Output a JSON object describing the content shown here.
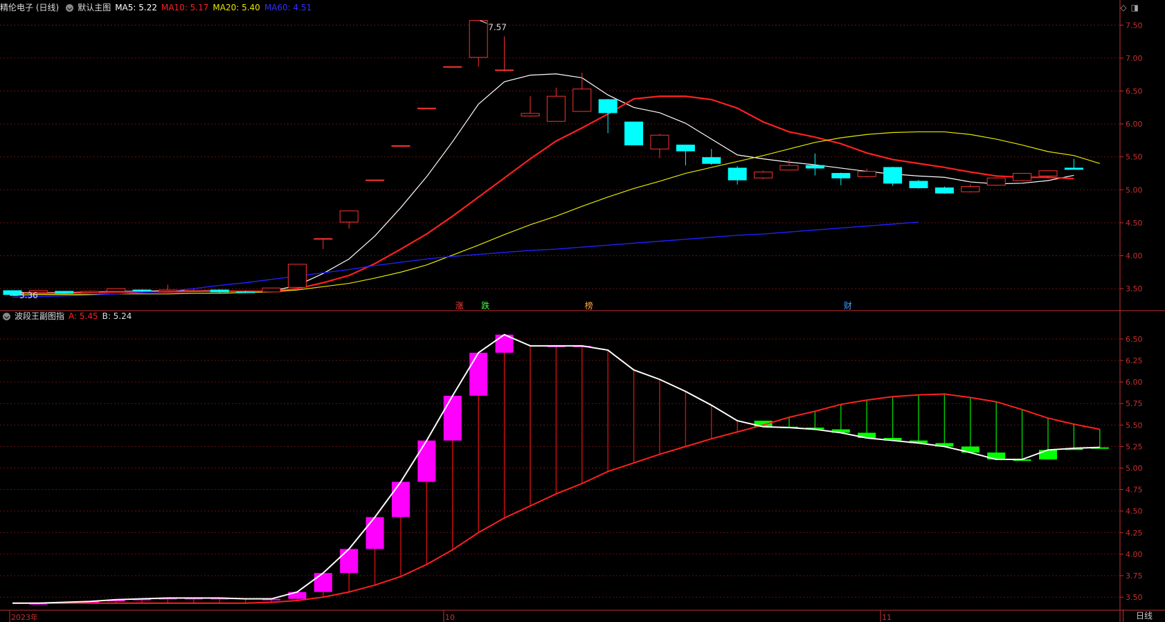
{
  "main_header": {
    "stock": "精伦电子 (日线)",
    "chart_name": "默认主图",
    "ma5": "MA5: 5.22",
    "ma10": "MA10: 5.17",
    "ma20": "MA20: 5.40",
    "ma60": "MA60: 4.51"
  },
  "sub_header": {
    "indicator": "波段王副图指",
    "a": "A: 5.45",
    "b": "B: 5.24"
  },
  "markers": [
    "涨",
    "跌",
    "榜",
    "财"
  ],
  "annotations": {
    "high": "7.57",
    "low": "3.36"
  },
  "x_labels": [
    "2023年",
    "10",
    "11"
  ],
  "period_tab": "日线",
  "icons": {
    "diamond": "diamond-icon",
    "window": "window-icon"
  },
  "colors": {
    "up": "#ff3232",
    "down": "#00ffff",
    "ma5": "#ffffff",
    "ma10": "#ff2020",
    "ma20": "#e8e800",
    "ma60": "#2020ff",
    "magenta": "#ff00ff",
    "green": "#00ff00"
  },
  "chart_data": [
    {
      "type": "candlestick",
      "title": "默认主图",
      "y_ticks": [
        "7.50",
        "7.00",
        "6.50",
        "6.00",
        "5.50",
        "5.00",
        "4.50",
        "4.00",
        "3.50"
      ],
      "ylim": [
        3.25,
        7.65
      ],
      "candles": [
        [
          3.47,
          3.41,
          3.47,
          3.41
        ],
        [
          3.44,
          3.47,
          3.47,
          3.43
        ],
        [
          3.46,
          3.43,
          3.46,
          3.42
        ],
        [
          3.44,
          3.46,
          3.47,
          3.43
        ],
        [
          3.46,
          3.5,
          3.5,
          3.45
        ],
        [
          3.48,
          3.47,
          3.49,
          3.45
        ],
        [
          3.46,
          3.48,
          3.56,
          3.45
        ],
        [
          3.47,
          3.47,
          3.5,
          3.45
        ],
        [
          3.48,
          3.45,
          3.49,
          3.43
        ],
        [
          3.45,
          3.44,
          3.47,
          3.43
        ],
        [
          3.45,
          3.51,
          3.51,
          3.44
        ],
        [
          3.52,
          3.87,
          3.87,
          3.52
        ],
        [
          4.26,
          4.26,
          4.26,
          4.1
        ],
        [
          4.51,
          4.68,
          4.68,
          4.41
        ],
        [
          5.15,
          5.15,
          5.15,
          5.15
        ],
        [
          5.67,
          5.67,
          5.67,
          5.67
        ],
        [
          6.24,
          6.24,
          6.24,
          6.24
        ],
        [
          6.87,
          6.87,
          6.87,
          6.87
        ],
        [
          7.01,
          7.57,
          7.57,
          6.87
        ],
        [
          6.82,
          6.82,
          7.33,
          6.8
        ],
        [
          6.12,
          6.16,
          6.42,
          6.11
        ],
        [
          6.04,
          6.42,
          6.55,
          6.04
        ],
        [
          6.19,
          6.53,
          6.78,
          6.19
        ],
        [
          6.37,
          6.17,
          6.38,
          5.86
        ],
        [
          6.03,
          5.68,
          6.03,
          5.68
        ],
        [
          5.62,
          5.83,
          5.85,
          5.48
        ],
        [
          5.68,
          5.59,
          5.68,
          5.37
        ],
        [
          5.49,
          5.4,
          5.62,
          5.38
        ],
        [
          5.33,
          5.15,
          5.36,
          5.08
        ],
        [
          5.18,
          5.27,
          5.29,
          5.16
        ],
        [
          5.3,
          5.37,
          5.46,
          5.3
        ],
        [
          5.37,
          5.33,
          5.55,
          5.22
        ],
        [
          5.25,
          5.18,
          5.26,
          5.07
        ],
        [
          5.2,
          5.28,
          5.32,
          5.19
        ],
        [
          5.34,
          5.1,
          5.35,
          5.06
        ],
        [
          5.13,
          5.03,
          5.15,
          5.02
        ],
        [
          5.03,
          4.95,
          5.05,
          4.94
        ],
        [
          4.97,
          5.05,
          5.08,
          4.96
        ],
        [
          5.07,
          5.18,
          5.19,
          5.06
        ],
        [
          5.14,
          5.25,
          5.25,
          5.13
        ],
        [
          5.21,
          5.29,
          5.3,
          5.17
        ],
        [
          5.33,
          5.31,
          5.47,
          5.31
        ]
      ],
      "series": [
        {
          "name": "MA5",
          "values": [
            3.44,
            3.44,
            3.44,
            3.45,
            3.46,
            3.46,
            3.47,
            3.47,
            3.47,
            3.46,
            3.46,
            3.55,
            3.73,
            3.95,
            4.3,
            4.73,
            5.2,
            5.73,
            6.3,
            6.64,
            6.74,
            6.76,
            6.7,
            6.44,
            6.25,
            6.17,
            6.01,
            5.77,
            5.53,
            5.47,
            5.42,
            5.38,
            5.33,
            5.28,
            5.24,
            5.21,
            5.19,
            5.12,
            5.09,
            5.1,
            5.14,
            5.22
          ]
        },
        {
          "name": "MA10",
          "values": [
            3.43,
            3.43,
            3.43,
            3.44,
            3.45,
            3.45,
            3.45,
            3.46,
            3.46,
            3.46,
            3.46,
            3.5,
            3.59,
            3.7,
            3.88,
            4.1,
            4.33,
            4.6,
            4.89,
            5.18,
            5.47,
            5.74,
            5.94,
            6.15,
            6.38,
            6.42,
            6.42,
            6.37,
            6.24,
            6.03,
            5.88,
            5.8,
            5.7,
            5.56,
            5.46,
            5.4,
            5.34,
            5.27,
            5.21,
            5.19,
            5.19,
            5.17
          ]
        },
        {
          "name": "MA20",
          "values": [
            3.4,
            3.41,
            3.41,
            3.41,
            3.42,
            3.42,
            3.42,
            3.43,
            3.43,
            3.44,
            3.45,
            3.48,
            3.53,
            3.58,
            3.66,
            3.75,
            3.86,
            4.01,
            4.16,
            4.32,
            4.47,
            4.6,
            4.75,
            4.89,
            5.02,
            5.13,
            5.25,
            5.34,
            5.43,
            5.52,
            5.62,
            5.72,
            5.79,
            5.84,
            5.87,
            5.88,
            5.88,
            5.84,
            5.77,
            5.68,
            5.58,
            5.52,
            5.4
          ]
        },
        {
          "name": "MA60",
          "values": [
            3.37,
            3.38,
            3.39,
            3.4,
            3.42,
            3.44,
            3.46,
            3.5,
            3.55,
            3.59,
            3.64,
            3.69,
            3.74,
            3.79,
            3.85,
            3.9,
            3.95,
            3.99,
            4.02,
            4.05,
            4.08,
            4.1,
            4.13,
            4.16,
            4.19,
            4.22,
            4.25,
            4.28,
            4.31,
            4.33,
            4.36,
            4.39,
            4.42,
            4.45,
            4.48,
            4.51
          ]
        }
      ]
    },
    {
      "type": "band",
      "title": "波段王副图指",
      "y_ticks": [
        "6.50",
        "6.25",
        "6.00",
        "5.75",
        "5.50",
        "5.25",
        "5.00",
        "4.75",
        "4.50",
        "4.25",
        "4.00",
        "3.75",
        "3.50"
      ],
      "ylim": [
        3.38,
        6.66
      ],
      "series": [
        {
          "name": "A",
          "values": [
            3.43,
            3.43,
            3.44,
            3.45,
            3.47,
            3.48,
            3.49,
            3.49,
            3.49,
            3.48,
            3.48,
            3.56,
            3.78,
            4.06,
            4.43,
            4.84,
            5.32,
            5.84,
            6.34,
            6.55,
            6.42,
            6.42,
            6.42,
            6.37,
            6.14,
            6.03,
            5.89,
            5.73,
            5.55,
            5.48,
            5.47,
            5.45,
            5.41,
            5.35,
            5.32,
            5.29,
            5.25,
            5.18,
            5.1,
            5.1,
            5.21,
            5.23,
            5.24
          ]
        },
        {
          "name": "B",
          "values": [
            3.43,
            3.43,
            3.43,
            3.43,
            3.43,
            3.43,
            3.43,
            3.43,
            3.43,
            3.43,
            3.44,
            3.46,
            3.5,
            3.56,
            3.64,
            3.74,
            3.88,
            4.05,
            4.25,
            4.42,
            4.56,
            4.7,
            4.82,
            4.96,
            5.06,
            5.16,
            5.25,
            5.34,
            5.42,
            5.5,
            5.59,
            5.66,
            5.74,
            5.79,
            5.83,
            5.85,
            5.86,
            5.82,
            5.77,
            5.68,
            5.58,
            5.51,
            5.45
          ]
        }
      ]
    }
  ]
}
